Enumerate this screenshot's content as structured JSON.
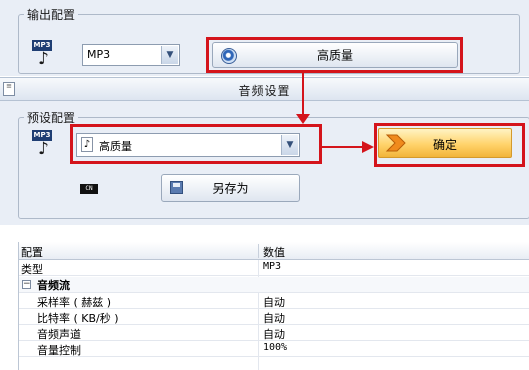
{
  "output_config": {
    "legend": "输出配置",
    "format_select": {
      "value": "MP3"
    },
    "quality_button": {
      "label": "高质量"
    },
    "mp3_icon_tag": "MP3"
  },
  "audio_settings": {
    "title": "音频设置"
  },
  "preset_config": {
    "legend": "预设配置",
    "preset_select": {
      "value": "高质量"
    },
    "confirm_button": {
      "label": "确定"
    },
    "save_as_button": {
      "label": "另存为"
    },
    "mp3_icon_tag": "MP3",
    "cn_icon_text": "CN"
  },
  "properties": {
    "headers": [
      "配置",
      "数值"
    ],
    "rows": [
      {
        "name": "类型",
        "value": "MP3"
      },
      {
        "name": "音频流",
        "value": ""
      },
      {
        "name": "采样率 ( 赫兹 )",
        "value": "自动"
      },
      {
        "name": "比特率 ( KB/秒 )",
        "value": "自动"
      },
      {
        "name": "音频声道",
        "value": "自动"
      },
      {
        "name": "音量控制",
        "value": "100%"
      }
    ]
  },
  "colors": {
    "highlight_red": "#d4141b",
    "panel_bg": "#e9eef6",
    "confirm_gold": "#ffd36b"
  }
}
